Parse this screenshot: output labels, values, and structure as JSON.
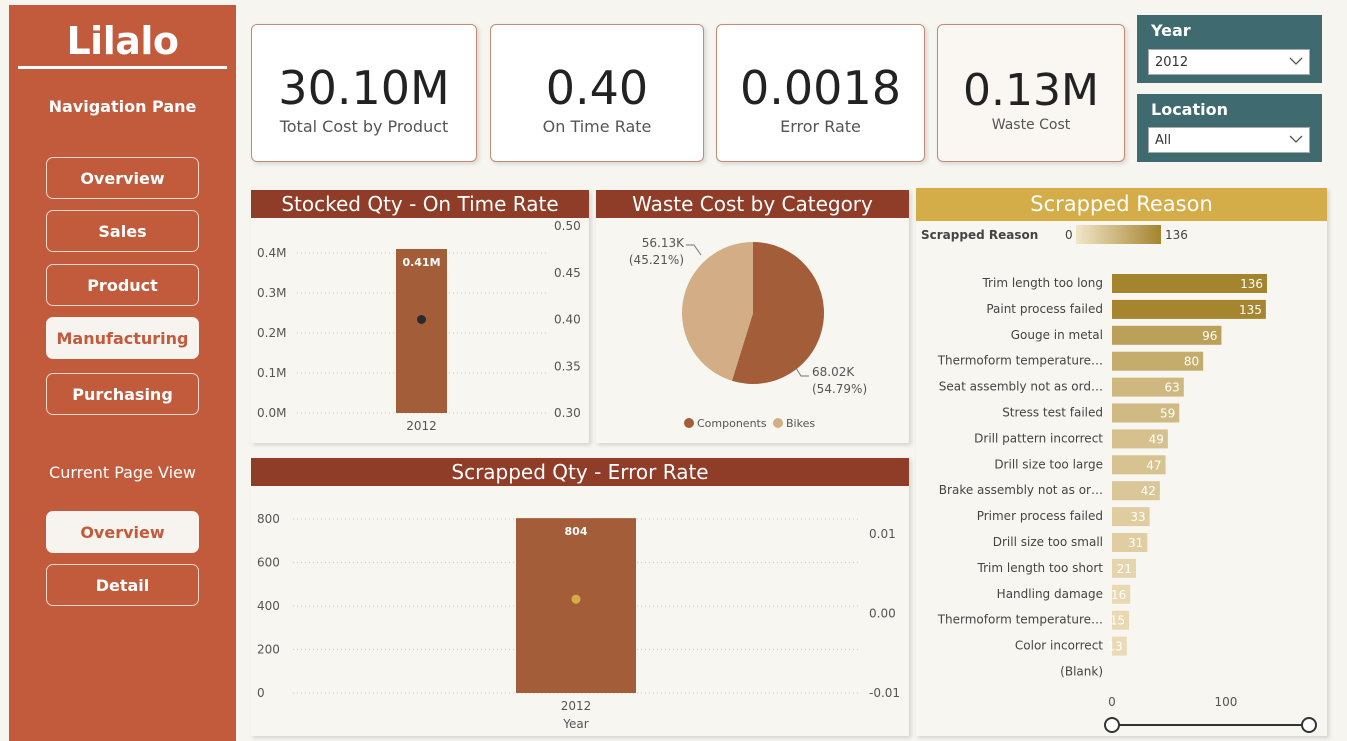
{
  "sidebar": {
    "brand": "Lilalo",
    "nav_title": "Navigation Pane",
    "nav_items": [
      "Overview",
      "Sales",
      "Product",
      "Manufacturing",
      "Purchasing"
    ],
    "active_nav": "Manufacturing",
    "current_page_title": "Current Page View",
    "page_items": [
      "Overview",
      "Detail"
    ],
    "active_page": "Overview"
  },
  "kpis": [
    {
      "value": "30.10M",
      "label": "Total Cost by Product"
    },
    {
      "value": "0.40",
      "label": "On Time Rate"
    },
    {
      "value": "0.0018",
      "label": "Error Rate"
    },
    {
      "value": "0.13M",
      "label": "Waste Cost"
    }
  ],
  "slicers": {
    "year": {
      "title": "Year",
      "value": "2012"
    },
    "location": {
      "title": "Location",
      "value": "All"
    }
  },
  "colors": {
    "sidebar": "#c25a3c",
    "header_red": "#8f3d28",
    "header_gold": "#d4ad48",
    "bar_brown": "#a35d38",
    "pie_light": "#d2ad85",
    "slicer_teal": "#3f6a70"
  },
  "chart_data": [
    {
      "id": "stocked",
      "type": "bar",
      "title": "Stocked Qty - On Time Rate",
      "categories": [
        "2012"
      ],
      "series": [
        {
          "name": "Stocked Qty",
          "values": [
            410000
          ],
          "axis": "left",
          "data_labels": [
            "0.41M"
          ]
        },
        {
          "name": "On Time Rate",
          "values": [
            0.4
          ],
          "axis": "right",
          "mark": "point"
        }
      ],
      "left_ticks": [
        "0.0M",
        "0.1M",
        "0.2M",
        "0.3M",
        "0.4M"
      ],
      "right_ticks": [
        "0.30",
        "0.35",
        "0.40",
        "0.45",
        "0.50"
      ],
      "ylim_left": [
        0,
        410000
      ],
      "ylim_right": [
        0.3,
        0.5
      ]
    },
    {
      "id": "waste",
      "type": "pie",
      "title": "Waste Cost by Category",
      "slices": [
        {
          "name": "Components",
          "value": 68020,
          "label": "68.02K",
          "pct": "(54.79%)"
        },
        {
          "name": "Bikes",
          "value": 56130,
          "label": "56.13K",
          "pct": "(45.21%)"
        }
      ],
      "legend": [
        "Components",
        "Bikes"
      ]
    },
    {
      "id": "scrapped",
      "type": "bar",
      "title": "Scrapped Qty - Error Rate",
      "xlabel": "Year",
      "categories": [
        "2012"
      ],
      "series": [
        {
          "name": "Scrapped Qty",
          "values": [
            804
          ],
          "axis": "left",
          "data_labels": [
            "804"
          ]
        },
        {
          "name": "Error Rate",
          "values": [
            0.0018
          ],
          "axis": "right",
          "mark": "point"
        }
      ],
      "left_ticks": [
        "0",
        "200",
        "400",
        "600",
        "800"
      ],
      "right_ticks": [
        "-0.01",
        "0.00",
        "0.01"
      ],
      "ylim_left": [
        0,
        804
      ],
      "ylim_right": [
        -0.01,
        0.01
      ]
    },
    {
      "id": "reasons",
      "type": "bar",
      "orientation": "horizontal",
      "title": "Scrapped Reason",
      "legend_title": "Scrapped Reason",
      "legend_min": "0",
      "legend_max": "136",
      "categories": [
        "Trim length too long",
        "Paint process failed",
        "Gouge in metal",
        "Thermoform temperature…",
        "Seat assembly not as ord…",
        "Stress test failed",
        "Drill pattern incorrect",
        "Drill size too large",
        "Brake assembly not as or…",
        "Primer process failed",
        "Drill size too small",
        "Trim length too short",
        "Handling damage",
        "Thermoform temperature…",
        "Color incorrect",
        "(Blank)"
      ],
      "values": [
        136,
        135,
        96,
        80,
        63,
        59,
        49,
        47,
        42,
        33,
        31,
        21,
        16,
        15,
        13,
        null
      ],
      "value_labels": [
        "136",
        "135",
        "96",
        "80",
        "63",
        "59",
        "49",
        "47",
        "42",
        "33",
        "31",
        "21",
        "16",
        "15",
        "13",
        ""
      ],
      "x_ticks": [
        "0",
        "100"
      ],
      "xlim": [
        0,
        136
      ]
    }
  ]
}
